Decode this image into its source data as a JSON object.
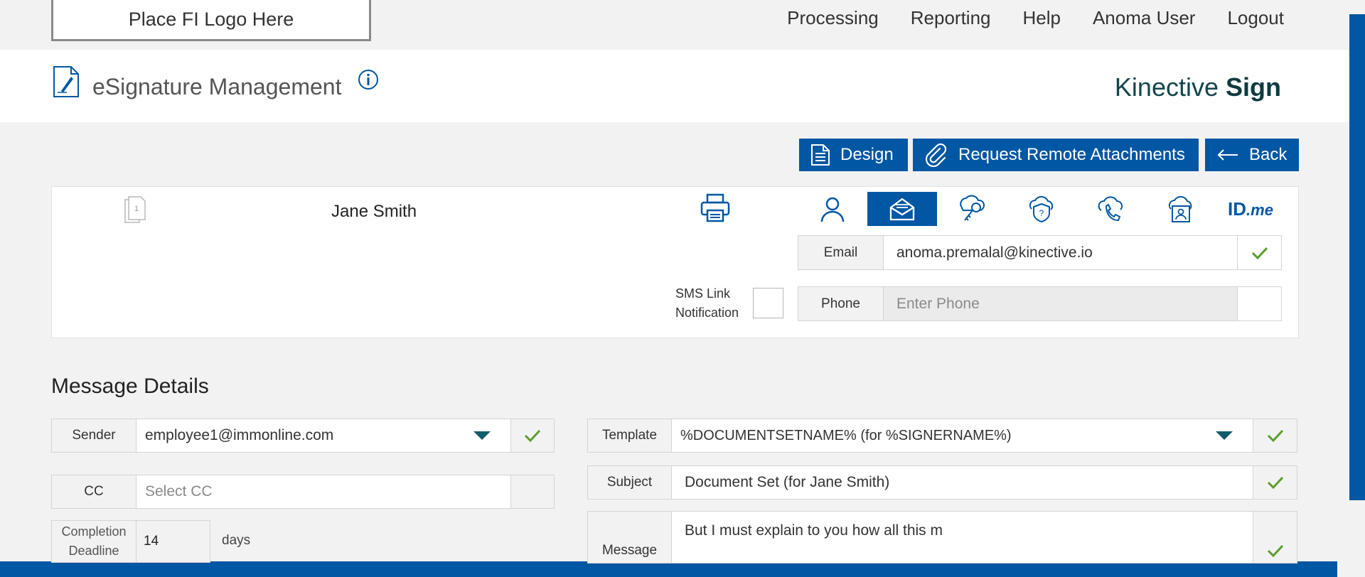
{
  "header": {
    "logo_placeholder": "Place FI Logo Here",
    "nav": [
      "Processing",
      "Reporting",
      "Help",
      "Anoma User",
      "Logout"
    ]
  },
  "titlebar": {
    "title": "eSignature Management",
    "brand_light": "Kinective ",
    "brand_bold": "Sign"
  },
  "actions": {
    "design": "Design",
    "remote_attachments": "Request Remote Attachments",
    "back": "Back"
  },
  "signer": {
    "page_number": "1",
    "name": "Jane Smith",
    "auth_methods": [
      "person-icon",
      "envelope-icon",
      "key-icon",
      "shield-question-icon",
      "phone-icon",
      "id-card-icon",
      "idme-logo"
    ],
    "active_method": "envelope-icon",
    "idme_text": "ID",
    "idme_suffix": ".me",
    "email_label": "Email",
    "email_value": "anoma.premalal@kinective.io",
    "phone_label": "Phone",
    "phone_placeholder": "Enter Phone",
    "sms_label_line1": "SMS Link",
    "sms_label_line2": "Notification",
    "sms_checked": false
  },
  "message": {
    "section_title": "Message Details",
    "sender_label": "Sender",
    "sender_value": "employee1@immonline.com",
    "cc_label": "CC",
    "cc_placeholder": "Select CC",
    "deadline_label_line1": "Completion",
    "deadline_label_line2": "Deadline",
    "deadline_value": "14",
    "deadline_unit": "days",
    "template_label": "Template",
    "template_value": "%DOCUMENTSETNAME% (for %SIGNERNAME%)",
    "subject_label": "Subject",
    "subject_value": "Document Set (for Jane Smith)",
    "message_label": "Message",
    "message_value": "But I must explain to you how all this m"
  },
  "colors": {
    "primary": "#0057a3",
    "check": "#5a9e2e",
    "brand": "#12464d"
  }
}
